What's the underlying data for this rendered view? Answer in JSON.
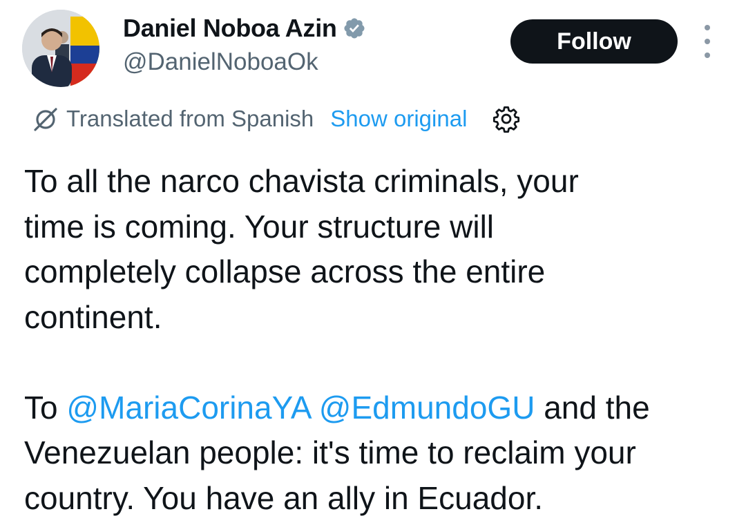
{
  "author": {
    "display_name": "Daniel Noboa Azin",
    "handle": "@DanielNoboaOk",
    "verified": true,
    "verified_icon": "verified-badge-icon",
    "verified_color": "#829aab"
  },
  "actions": {
    "follow_label": "Follow",
    "more_icon": "more-dots-icon"
  },
  "translation": {
    "translated_label": "Translated from Spanish",
    "show_original_label": "Show original",
    "translate_icon": "translate-icon",
    "settings_icon": "gear-icon"
  },
  "tweet": {
    "paragraph1": "To all the narco chavista criminals, your time is coming. Your structure will completely collapse across the entire continent.",
    "paragraph2_prefix": "To ",
    "mention1": "@MariaCorinaYA",
    "mention_separator": " ",
    "mention2": "@EdmundoGU",
    "paragraph2_suffix": " and the Venezuelan people: it's time to reclaim your country. You have an ally in Ecuador."
  },
  "colors": {
    "text": "#0f1419",
    "secondary": "#536471",
    "link": "#1d9bf0",
    "button_bg": "#0f1419",
    "button_text": "#ffffff"
  }
}
